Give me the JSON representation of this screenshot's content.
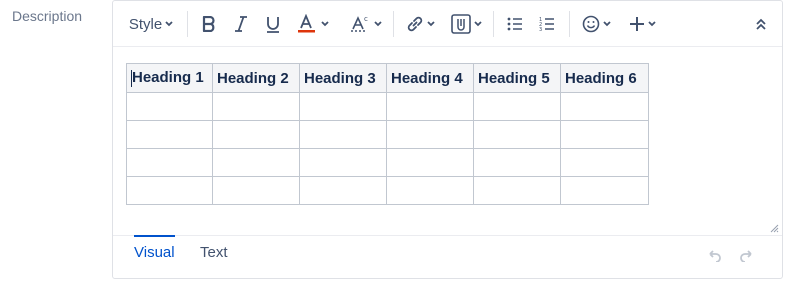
{
  "field": {
    "label": "Description"
  },
  "toolbar": {
    "style_label": "Style",
    "icons": [
      "bold-icon",
      "italic-icon",
      "underline-icon",
      "text-color-icon",
      "clear-format-icon",
      "link-icon",
      "attachment-icon",
      "bullet-list-icon",
      "numbered-list-icon",
      "emoji-icon",
      "insert-plus-icon",
      "collapse-toolbar-icon"
    ],
    "text_color_accent": "#de350b"
  },
  "table": {
    "headers": [
      "Heading 1",
      "Heading 2",
      "Heading 3",
      "Heading 4",
      "Heading 5",
      "Heading 6"
    ],
    "rows": [
      [
        "",
        "",
        "",
        "",
        "",
        ""
      ],
      [
        "",
        "",
        "",
        "",
        "",
        ""
      ],
      [
        "",
        "",
        "",
        "",
        "",
        ""
      ],
      [
        "",
        "",
        "",
        "",
        "",
        ""
      ]
    ]
  },
  "footer": {
    "tabs": [
      {
        "label": "Visual",
        "active": true
      },
      {
        "label": "Text",
        "active": false
      }
    ]
  },
  "colors": {
    "accent": "#0052cc",
    "border": "#dfe1e6",
    "header_bg": "#f4f5f7"
  }
}
